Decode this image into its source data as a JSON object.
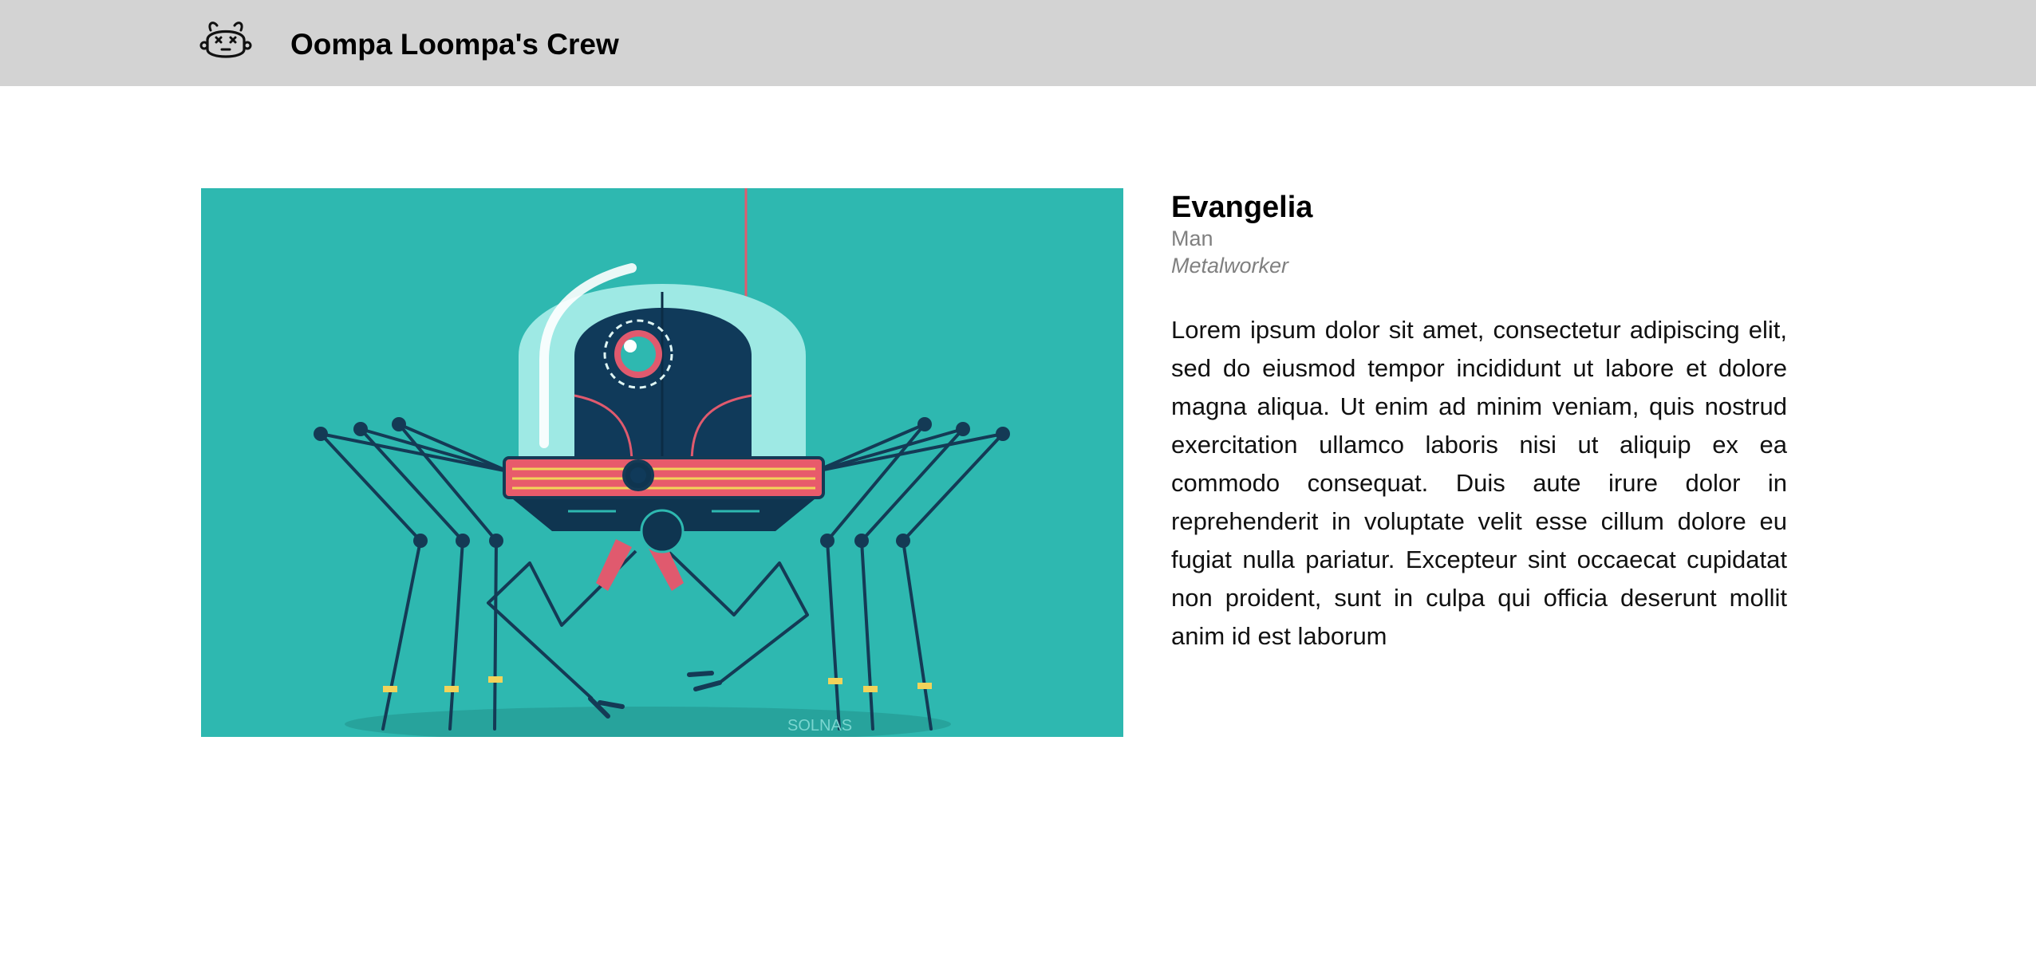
{
  "header": {
    "title": "Oompa Loompa's Crew",
    "logo_icon": "robot-face-icon",
    "background": "#d3d3d3"
  },
  "profile": {
    "name": "Evangelia",
    "gender": "Man",
    "profession": "Metalworker",
    "description": "Lorem ipsum dolor sit amet, consectetur adipiscing elit, sed do eiusmod tempor incididunt ut labore et dolore magna aliqua. Ut enim ad minim veniam, quis nostrud exercitation ullamco laboris nisi ut aliquip ex ea commodo consequat. Duis aute irure dolor in reprehenderit in voluptate velit esse cillum dolore eu fugiat nulla pariatur. Excepteur sint occaecat cupidatat non proident, sunt in culpa qui officia deserunt mollit anim id est laborum",
    "image": {
      "icon": "spider-robot-illustration",
      "background": "#2eb8b0",
      "signature": "SOLNAS"
    }
  }
}
